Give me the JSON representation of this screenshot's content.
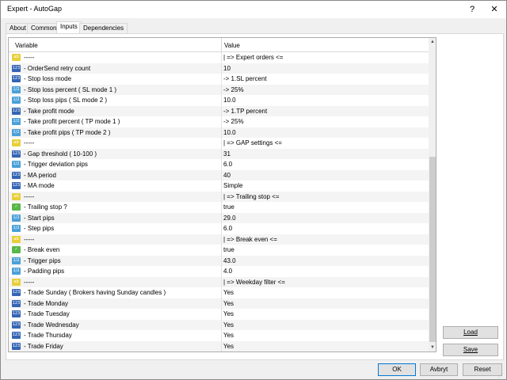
{
  "window": {
    "title": "Expert - AutoGap",
    "help": "?",
    "close": "✕"
  },
  "tabs": [
    "About",
    "Common",
    "Inputs",
    "Dependencies"
  ],
  "grid": {
    "col_variable": "Variable",
    "col_value": "Value",
    "rows": [
      {
        "icon": "ab",
        "var": "-----",
        "val": "| => Expert orders <="
      },
      {
        "icon": "123",
        "var": "- OrderSend retry count",
        "val": "10"
      },
      {
        "icon": "123",
        "var": "- Stop loss mode",
        "val": "-> 1.SL percent"
      },
      {
        "icon": "v2",
        "var": "- Stop loss percent ( SL mode 1 )",
        "val": "-> 25%"
      },
      {
        "icon": "v2",
        "var": "- Stop loss pips ( SL mode 2 )",
        "val": "10.0"
      },
      {
        "icon": "123",
        "var": "- Take profit mode",
        "val": "-> 1.TP percent"
      },
      {
        "icon": "v2",
        "var": "- Take profit percent ( TP mode 1 )",
        "val": "-> 25%"
      },
      {
        "icon": "v2",
        "var": "- Take profit pips ( TP mode 2 )",
        "val": "10.0"
      },
      {
        "icon": "ab",
        "var": "-----",
        "val": "| => GAP settings <="
      },
      {
        "icon": "123",
        "var": "- Gap threshold ( 10-100 )",
        "val": "31"
      },
      {
        "icon": "v2",
        "var": "- Trigger deviation pips",
        "val": "6.0"
      },
      {
        "icon": "123",
        "var": "- MA period",
        "val": "40"
      },
      {
        "icon": "123",
        "var": "- MA mode",
        "val": "Simple"
      },
      {
        "icon": "ab",
        "var": "-----",
        "val": "| => Trailing stop <="
      },
      {
        "icon": "bool",
        "var": "- Trailing stop ?",
        "val": "true"
      },
      {
        "icon": "v2",
        "var": "- Start pips",
        "val": "29.0"
      },
      {
        "icon": "v2",
        "var": "- Step pips",
        "val": "6.0"
      },
      {
        "icon": "ab",
        "var": "-----",
        "val": "| => Break even <="
      },
      {
        "icon": "bool",
        "var": "- Break even",
        "val": "true"
      },
      {
        "icon": "v2",
        "var": "- Trigger pips",
        "val": "43.0"
      },
      {
        "icon": "v2",
        "var": "- Padding pips",
        "val": "4.0"
      },
      {
        "icon": "ab",
        "var": "-----",
        "val": "| => Weekday filter <="
      },
      {
        "icon": "123",
        "var": "- Trade Sunday ( Brokers having Sunday candles )",
        "val": "Yes"
      },
      {
        "icon": "123",
        "var": "- Trade Monday",
        "val": "Yes"
      },
      {
        "icon": "123",
        "var": "- Trade Tuesday",
        "val": "Yes"
      },
      {
        "icon": "123",
        "var": "- Trade Wednesday",
        "val": "Yes"
      },
      {
        "icon": "123",
        "var": "- Trade Thursday",
        "val": "Yes"
      },
      {
        "icon": "123",
        "var": "- Trade Friday",
        "val": "Yes"
      }
    ]
  },
  "buttons": {
    "load": "Load",
    "save": "Save",
    "ok": "OK",
    "cancel": "Avbryt",
    "reset": "Reset"
  },
  "icons": {
    "ab": "ab",
    "123": "123",
    "v2": "1/2",
    "bool": "✓"
  }
}
